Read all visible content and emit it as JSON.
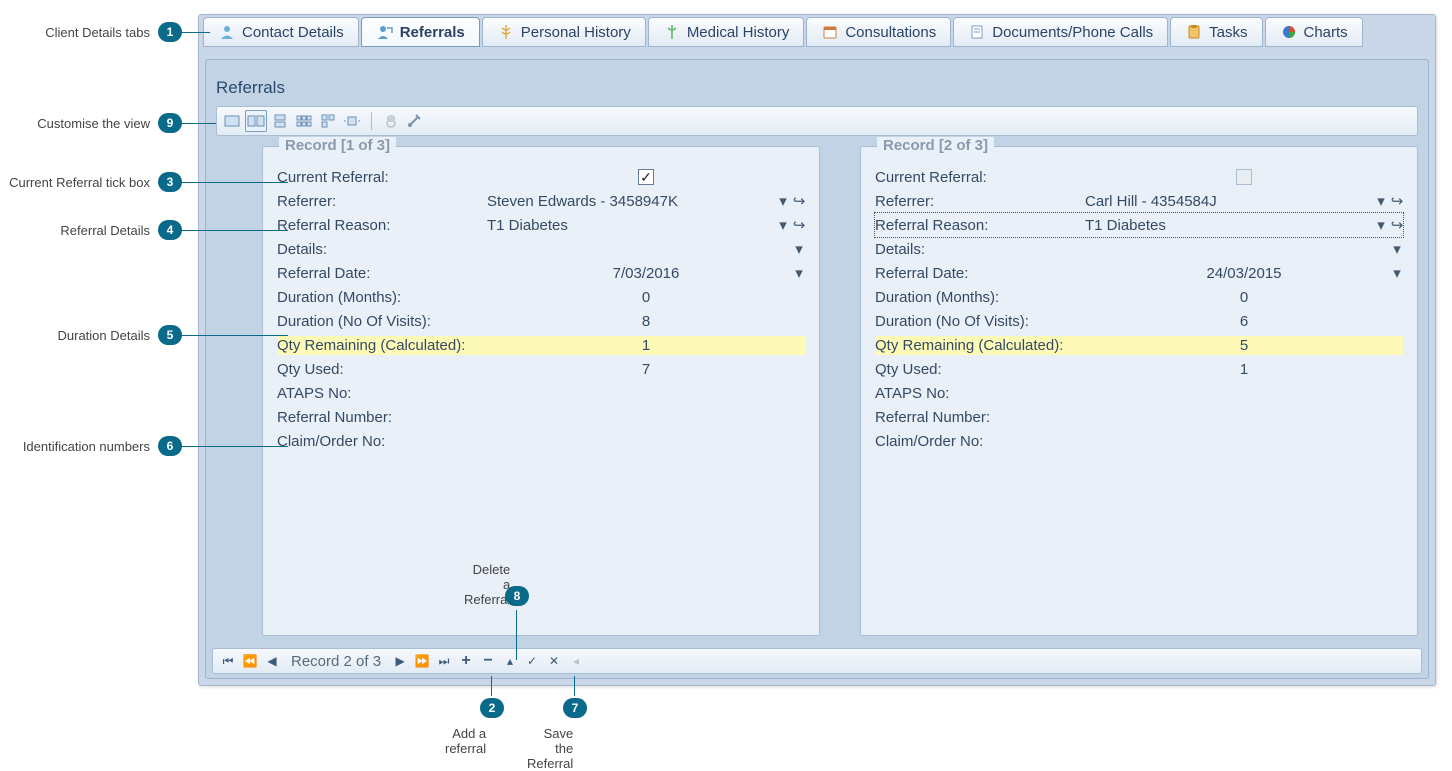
{
  "tabs": [
    {
      "label": "Contact Details"
    },
    {
      "label": "Referrals"
    },
    {
      "label": "Personal History"
    },
    {
      "label": "Medical History"
    },
    {
      "label": "Consultations"
    },
    {
      "label": "Documents/Phone Calls"
    },
    {
      "label": "Tasks"
    },
    {
      "label": "Charts"
    }
  ],
  "active_tab": "Referrals",
  "panel_title": "Referrals",
  "records": [
    {
      "legend": "Record [1 of 3]",
      "current": true,
      "referrer": "Steven Edwards - 3458947K",
      "reason": "T1 Diabetes",
      "details": "",
      "date": "7/03/2016",
      "duration_months": "0",
      "duration_visits": "8",
      "qty_remaining": "1",
      "qty_used": "7",
      "ataps": "",
      "referral_no": "",
      "claim_no": ""
    },
    {
      "legend": "Record [2 of 3]",
      "current": false,
      "referrer": "Carl Hill - 4354584J",
      "reason": "T1 Diabetes",
      "details": "",
      "date": "24/03/2015",
      "duration_months": "0",
      "duration_visits": "6",
      "qty_remaining": "5",
      "qty_used": "1",
      "ataps": "",
      "referral_no": "",
      "claim_no": ""
    }
  ],
  "field_labels": {
    "current": "Current Referral:",
    "referrer": "Referrer:",
    "reason": "Referral Reason:",
    "details": "Details:",
    "date": "Referral Date:",
    "duration_months": "Duration (Months):",
    "duration_visits": "Duration (No Of Visits):",
    "qty_remaining": "Qty Remaining (Calculated):",
    "qty_used": "Qty Used:",
    "ataps": "ATAPS No:",
    "referral_no": "Referral Number:",
    "claim_no": "Claim/Order No:"
  },
  "navigator_text": "Record 2 of 3",
  "callouts": {
    "1": "Client Details tabs",
    "9": "Customise the view",
    "3": "Current Referral tick box",
    "4": "Referral Details",
    "5": "Duration Details",
    "6": "Identification numbers",
    "8": "Delete a Referral",
    "2": "Add a referral",
    "7": "Save the Referral"
  }
}
